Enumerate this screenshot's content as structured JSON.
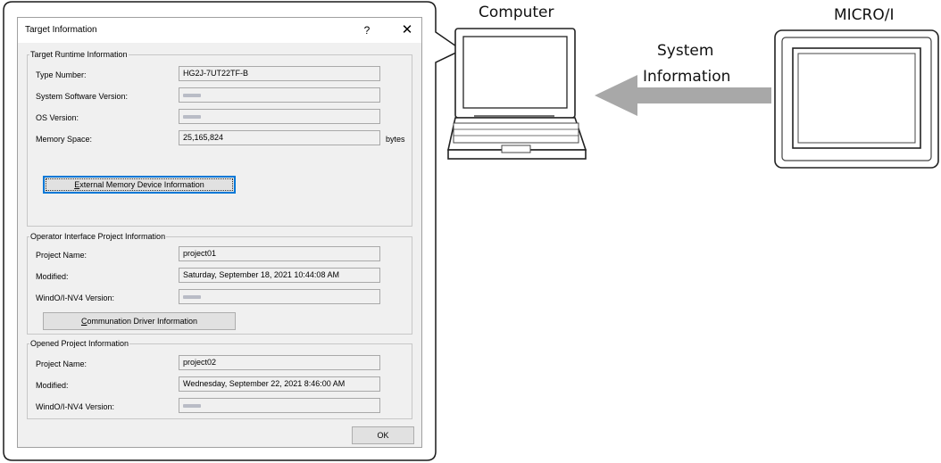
{
  "dialog": {
    "title": "Target Information",
    "help_glyph": "?",
    "close_glyph": "✕",
    "runtime": {
      "legend": "Target Runtime Information",
      "type_number_label": "Type Number:",
      "type_number_value": "HG2J-7UT22TF-B",
      "system_software_label": "System Software Version:",
      "os_version_label": "OS Version:",
      "memory_space_label": "Memory Space:",
      "memory_space_value": "25,165,824",
      "memory_unit": "bytes",
      "external_memory_button_key": "E",
      "external_memory_button_rest": "xternal Memory Device Information"
    },
    "operator": {
      "legend": "Operator Interface Project Information",
      "project_name_label": "Project Name:",
      "project_name_value": "project01",
      "modified_label": "Modified:",
      "modified_value": "Saturday, September 18, 2021 10:44:08 AM",
      "windoi_label": "WindO/I-NV4 Version:",
      "driver_button_key": "C",
      "driver_button_rest": "ommunation Driver Information"
    },
    "opened": {
      "legend": "Opened Project Information",
      "project_name_label": "Project Name:",
      "project_name_value": "project02",
      "modified_label": "Modified:",
      "modified_value": "Wednesday, September 22, 2021 8:46:00 AM",
      "windoi_label": "WindO/I-NV4 Version:"
    },
    "ok_label": "OK"
  },
  "diagram": {
    "computer_label": "Computer",
    "micro_label": "MICRO/I",
    "arrow_label_line1": "System",
    "arrow_label_line2": "Information",
    "arrow_color": "#a8a8a8"
  }
}
